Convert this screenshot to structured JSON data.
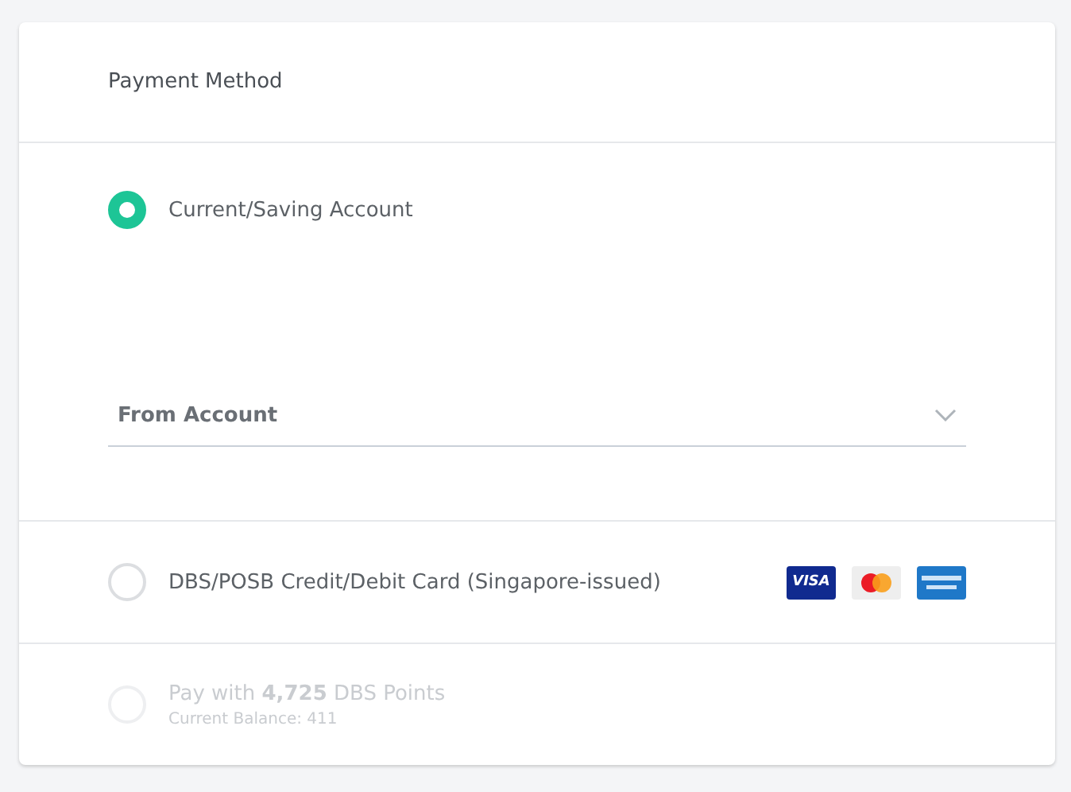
{
  "title": "Payment Method",
  "options": [
    {
      "kind": "account",
      "label": "Current/Saving Account",
      "selected": true,
      "disabled": false,
      "dropdown": {
        "placeholder": "From Account"
      }
    },
    {
      "kind": "card",
      "label": "DBS/POSB Credit/Debit Card (Singapore-issued)",
      "selected": false,
      "disabled": false,
      "cards": [
        {
          "kind": "visa",
          "text": "VISA"
        },
        {
          "kind": "mastercard"
        },
        {
          "kind": "amex"
        }
      ]
    },
    {
      "kind": "points",
      "label": "Pay with **4,725** DBS Points",
      "sublabel": "Current Balance: 411",
      "selected": false,
      "disabled": true
    }
  ]
}
